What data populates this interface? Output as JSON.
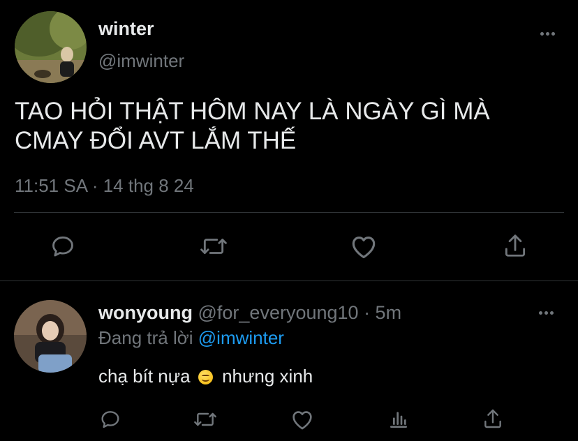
{
  "tweet": {
    "author": {
      "name": "winter",
      "handle": "@imwinter"
    },
    "text_line1": "TAO HỎI THẬT HÔM NAY LÀ NGÀY GÌ MÀ",
    "text_line2": "CMAY ĐỔI AVT LẮM THẾ",
    "timestamp": "11:51 SA · 14 thg 8 24"
  },
  "reply": {
    "author": {
      "name": "wonyoung",
      "handle": "@for_everyoung10",
      "time": " · 5m"
    },
    "replying_prefix": "Đang trả lời ",
    "replying_to": "@imwinter",
    "text_before_emoji": "chạ bít nựa",
    "text_after_emoji": "nhưng xinh"
  },
  "icons": {
    "reply": "reply-icon",
    "retweet": "retweet-icon",
    "like": "like-icon",
    "share": "share-icon",
    "views": "views-icon",
    "more": "more-icon"
  },
  "colors": {
    "background": "#000000",
    "text": "#e7e9ea",
    "muted": "#71767b",
    "link": "#1d9bf0",
    "divider": "#2f3336"
  }
}
